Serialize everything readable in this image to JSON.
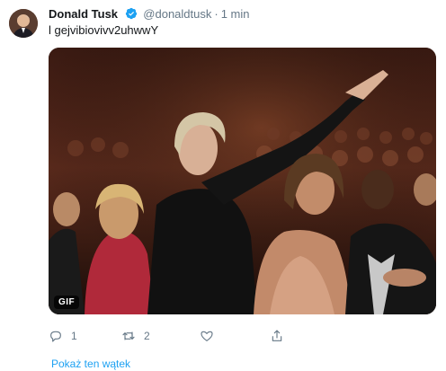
{
  "tweet": {
    "author_name": "Donald Tusk",
    "handle": "@donaldtusk",
    "separator": "·",
    "time": "1 min",
    "text": "l gejvibiovivv2uhwwY",
    "media_badge": "GIF",
    "actions": {
      "reply_count": "1",
      "retweet_count": "2",
      "like_count": ""
    },
    "show_thread_label": "Pokaż ten wątek"
  },
  "colors": {
    "accent": "#1da1f2",
    "secondary_text": "#657786"
  }
}
